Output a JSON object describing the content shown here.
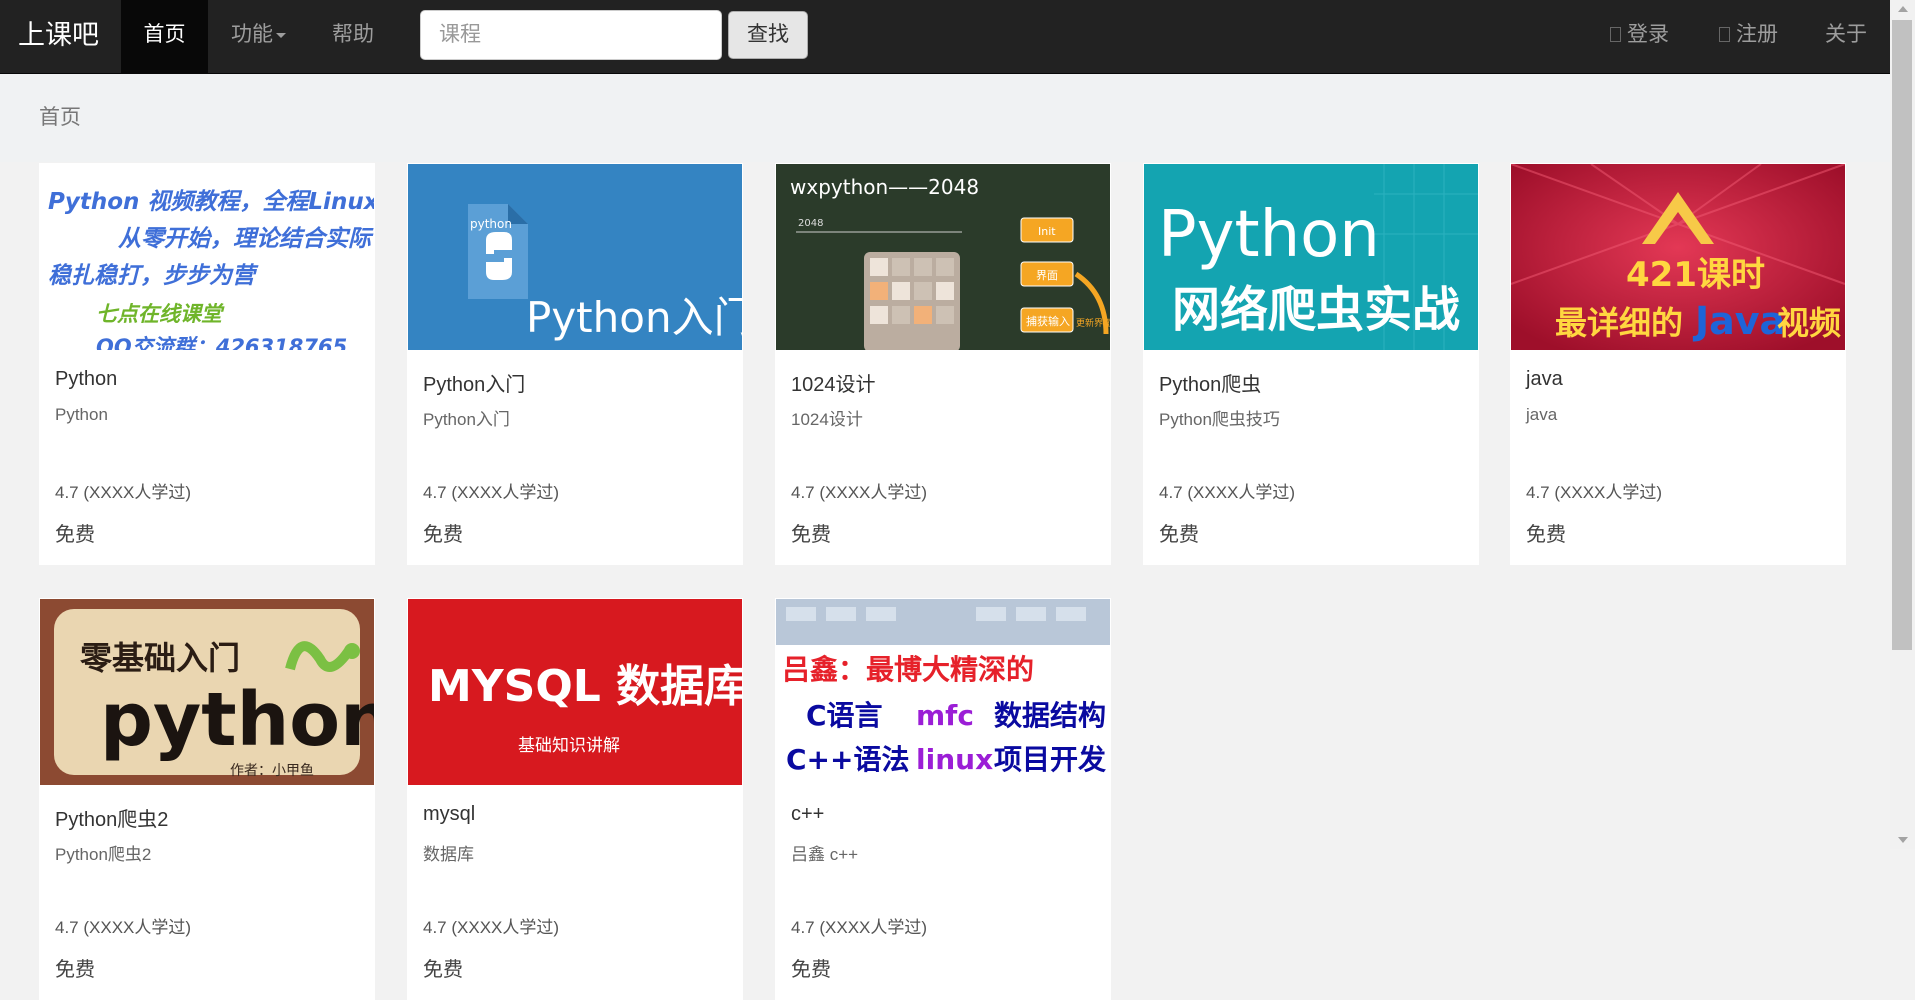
{
  "nav": {
    "brand": "上课吧",
    "home": "首页",
    "features": "功能",
    "help": "帮助",
    "search_placeholder": "课程",
    "search_button": "查找",
    "login": "登录",
    "register": "注册",
    "about": "关于"
  },
  "breadcrumb": "首页",
  "courses": [
    {
      "title": "Python",
      "subtitle": "Python",
      "rating": "4.7 (XXXX人学过)",
      "price": "免费",
      "thumb_lines": [
        "Python 视频教程，全程Linux教学",
        "从零开始，理论结合实际",
        "稳扎稳打，步步为营",
        "七点在线课堂",
        "QQ交流群：426318765"
      ]
    },
    {
      "title": "Python入门",
      "subtitle": "Python入门",
      "rating": "4.7 (XXXX人学过)",
      "price": "免费",
      "thumb_lines": [
        "python",
        "Python入门"
      ]
    },
    {
      "title": "1024设计",
      "subtitle": "1024设计",
      "rating": "4.7 (XXXX人学过)",
      "price": "免费",
      "thumb_lines": [
        "wxpython——2048",
        "2048",
        "Init",
        "界面",
        "捕获输入",
        "更新界面"
      ]
    },
    {
      "title": "Python爬虫",
      "subtitle": "Python爬虫技巧",
      "rating": "4.7 (XXXX人学过)",
      "price": "免费",
      "thumb_lines": [
        "Python",
        "网络爬虫实战"
      ]
    },
    {
      "title": "java",
      "subtitle": "java",
      "rating": "4.7 (XXXX人学过)",
      "price": "免费",
      "thumb_lines": [
        "421课时",
        "最详细的",
        "Java",
        "视频"
      ]
    },
    {
      "title": "Python爬虫2",
      "subtitle": "Python爬虫2",
      "rating": "4.7 (XXXX人学过)",
      "price": "免费",
      "thumb_lines": [
        "零基础入门",
        "python",
        "作者：小甲鱼"
      ]
    },
    {
      "title": "mysql",
      "subtitle": "数据库",
      "rating": "4.7 (XXXX人学过)",
      "price": "免费",
      "thumb_lines": [
        "MYSQL 数据库",
        "基础知识讲解"
      ]
    },
    {
      "title": "c++",
      "subtitle": "吕鑫 c++",
      "rating": "4.7 (XXXX人学过)",
      "price": "免费",
      "thumb_lines": [
        "吕鑫：最博大精深的",
        "C语言",
        "mfc",
        "数据结构",
        "C++语法",
        "linux",
        "项目开发"
      ]
    }
  ]
}
